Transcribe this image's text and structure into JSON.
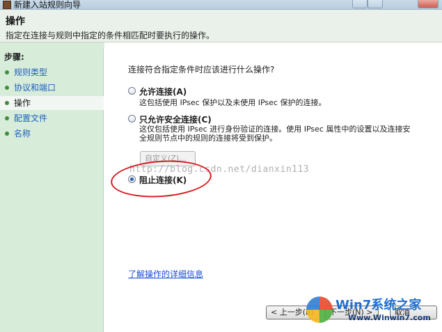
{
  "window": {
    "title": "新建入站规则向导"
  },
  "header": {
    "title": "操作",
    "subtitle": "指定在连接与规则中指定的条件相匹配时要执行的操作。"
  },
  "sidebar": {
    "steps_label": "步骤:",
    "items": [
      {
        "label": "规则类型",
        "active": false
      },
      {
        "label": "协议和端口",
        "active": false
      },
      {
        "label": "操作",
        "active": true
      },
      {
        "label": "配置文件",
        "active": false
      },
      {
        "label": "名称",
        "active": false
      }
    ]
  },
  "main": {
    "question": "连接符合指定条件时应该进行什么操作?",
    "options": [
      {
        "label": "允许连接(A)",
        "desc": [
          "这包括使用 IPsec 保护以及未使用 IPsec 保护的连接。"
        ],
        "checked": false
      },
      {
        "label": "只允许安全连接(C)",
        "desc": [
          "这仅包括使用 IPsec 进行身份验证的连接。使用 IPsec 属性中的设置以及连接安",
          "全规则节点中的规则的连接将受到保护。"
        ],
        "checked": false
      },
      {
        "label": "阻止连接(K)",
        "desc": [],
        "checked": true
      }
    ],
    "custom_button": "自定义(Z)...",
    "watermark": "http://blog.csdn.net/dianxin113",
    "learn_more": "了解操作的详细信息"
  },
  "footer": {
    "back": "< 上一步(B)",
    "next": "下一步(N) >",
    "cancel": "取消"
  },
  "logo": {
    "brand": "Win7系统之家",
    "site": "Www.Winwin7.com"
  },
  "colors": {
    "sidebar_bg": "#d7ecd9",
    "header_bg": "#eaf1ea",
    "link": "#1a4fd0",
    "annotation": "#d9181f"
  }
}
